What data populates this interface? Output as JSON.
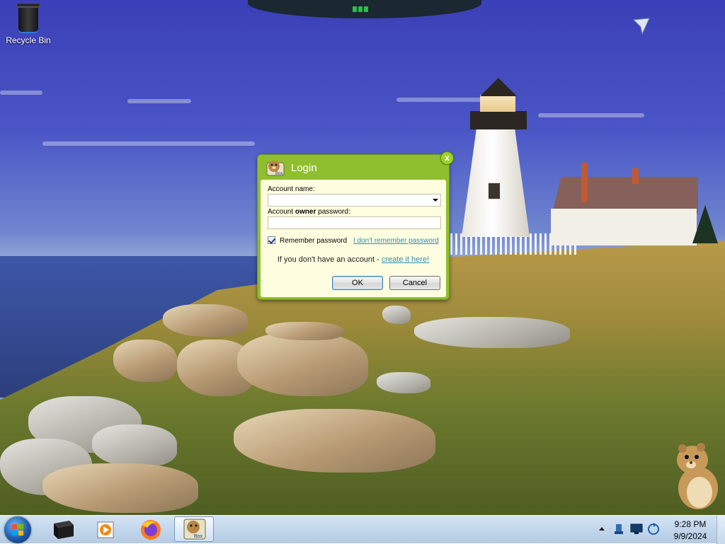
{
  "desktop": {
    "icons": [
      {
        "label": "Recycle Bin",
        "icon": "recycle-bin-icon"
      }
    ]
  },
  "dialog": {
    "title": "Login",
    "account_name_label": "Account name:",
    "account_name_value": "",
    "password_label_prefix": "Account ",
    "password_label_bold": "owner",
    "password_label_suffix": " password:",
    "password_value": "",
    "remember_password_label": "Remember password",
    "remember_password_checked": true,
    "forgot_password_link": "I don't remember password",
    "signup_text": "If you don't have an account - ",
    "signup_link": "create it here!",
    "ok_label": "OK",
    "cancel_label": "Cancel",
    "close_glyph": "x",
    "accent_color": "#8fbf2c"
  },
  "taskbar": {
    "items": [
      {
        "icon": "start-orb-icon"
      },
      {
        "icon": "black-box-icon"
      },
      {
        "icon": "media-player-icon"
      },
      {
        "icon": "firefox-icon"
      },
      {
        "icon": "box-app-icon",
        "active": true
      }
    ],
    "tray_icons": [
      "show-hidden-icons-chevron",
      "network-device-icon",
      "display-icon",
      "sync-icon"
    ],
    "clock_time": "9:28 PM",
    "clock_date": "9/9/2024"
  }
}
